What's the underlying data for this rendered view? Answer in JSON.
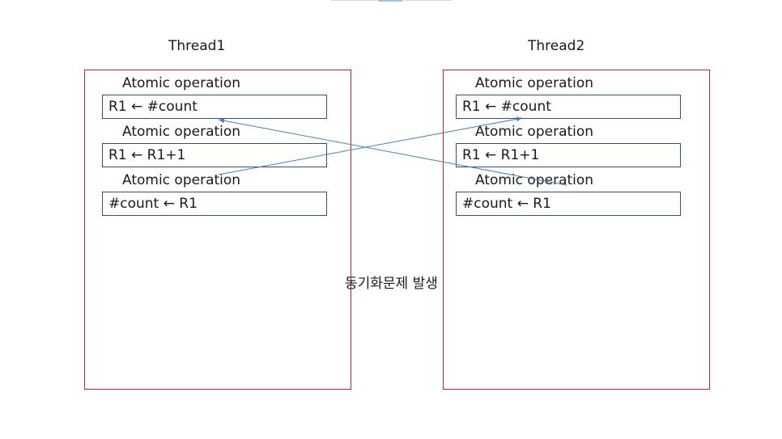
{
  "threads": [
    {
      "title": "Thread1",
      "operations": [
        {
          "label": "Atomic operation",
          "code": "R1 ← #count"
        },
        {
          "label": "Atomic operation",
          "code": "R1 ← R1+1"
        },
        {
          "label": "Atomic operation",
          "code": "#count ← R1"
        }
      ]
    },
    {
      "title": "Thread2",
      "operations": [
        {
          "label": "Atomic operation",
          "code": "R1 ← #count"
        },
        {
          "label": "Atomic operation",
          "code": "R1 ← R1+1"
        },
        {
          "label": "Atomic operation",
          "code": "#count ← R1"
        }
      ]
    }
  ],
  "center_note": "동기화문제 발생",
  "colors": {
    "frame": "#c9252c",
    "box": "#2f4f77",
    "arrow": "#4a7ebb"
  }
}
